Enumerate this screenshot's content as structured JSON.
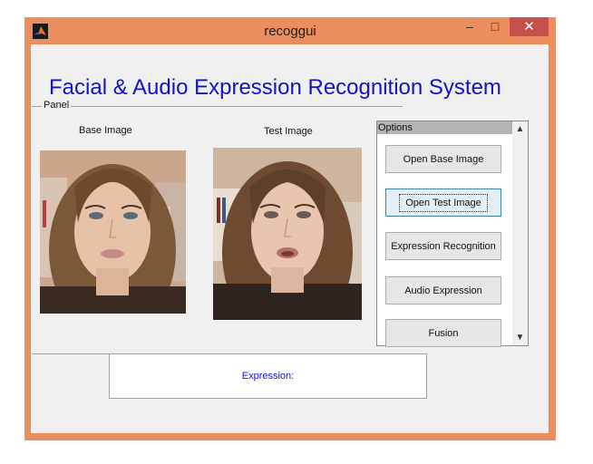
{
  "window": {
    "title": "recoggui"
  },
  "titlebar": {
    "minimize": "–",
    "maximize": "□",
    "close": "✕"
  },
  "heading": "Facial & Audio Expression Recognition System",
  "panel": {
    "label": "Panel",
    "base_image_label": "Base Image",
    "test_image_label": "Test Image"
  },
  "options": {
    "title": "Options",
    "buttons": [
      "Open Base Image",
      "Open Test Image",
      "Expression Recognition",
      "Audio Expression",
      "Fusion"
    ],
    "scroll_up": "▲",
    "scroll_down": "▼"
  },
  "result": {
    "label": "Expression:"
  },
  "colors": {
    "window_border": "#eb8d5e",
    "heading": "#1212c8",
    "close_button": "#c7504d"
  }
}
